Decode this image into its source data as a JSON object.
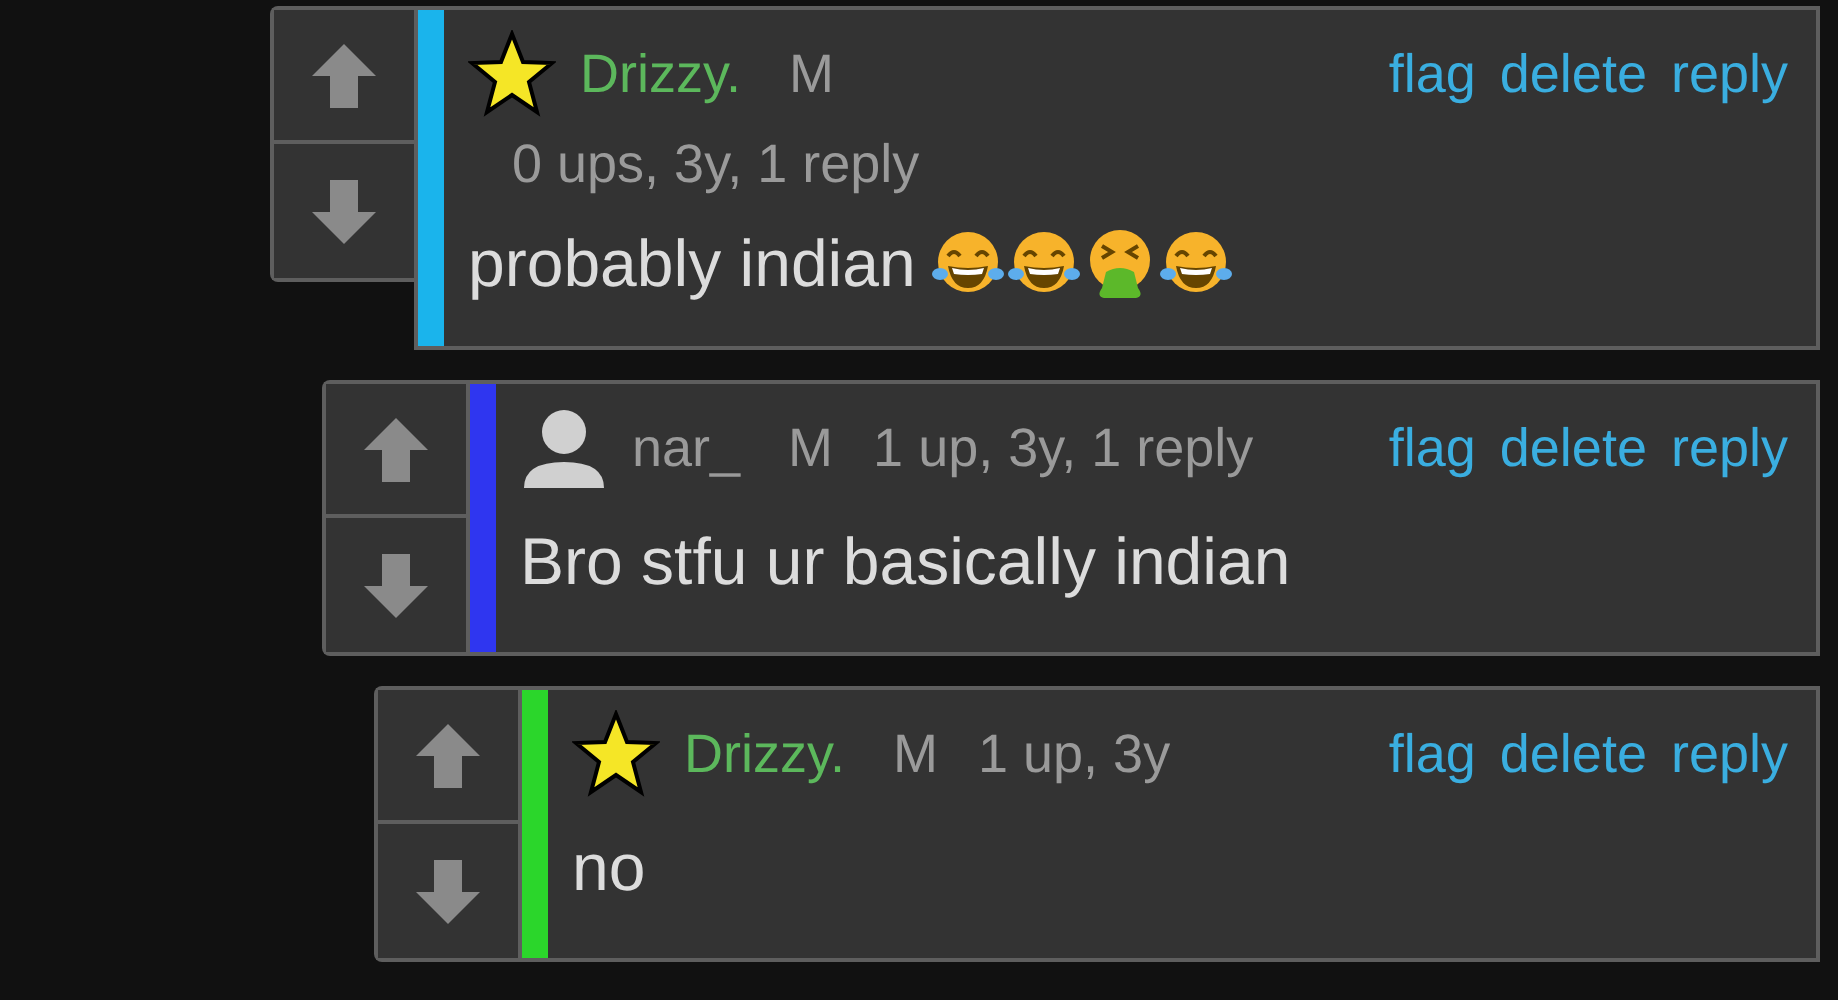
{
  "comments": [
    {
      "kind": "star",
      "name": "Drizzy.",
      "gender": "M",
      "meta": "0 ups, 3y, 1 reply",
      "color": "#1ab4ec",
      "actions": [
        "flag",
        "delete",
        "reply"
      ],
      "text": "probably indian",
      "emojis": [
        {
          "kind": "laughing"
        },
        {
          "kind": "laughing"
        },
        {
          "kind": "vomiting"
        },
        {
          "kind": "laughing"
        }
      ],
      "children": [
        {
          "kind": "avatar",
          "name": "nar_",
          "gender": "M",
          "meta": "1 up, 3y, 1 reply",
          "color": "#2f36f0",
          "actions": [
            "flag",
            "delete",
            "reply"
          ],
          "text": "Bro stfu ur basically indian",
          "children": [
            {
              "kind": "star",
              "name": "Drizzy.",
              "gender": "M",
              "meta": "1 up, 3y",
              "color": "#2bd62b",
              "actions": [
                "flag",
                "delete",
                "reply"
              ],
              "text": "no"
            }
          ]
        }
      ]
    }
  ]
}
